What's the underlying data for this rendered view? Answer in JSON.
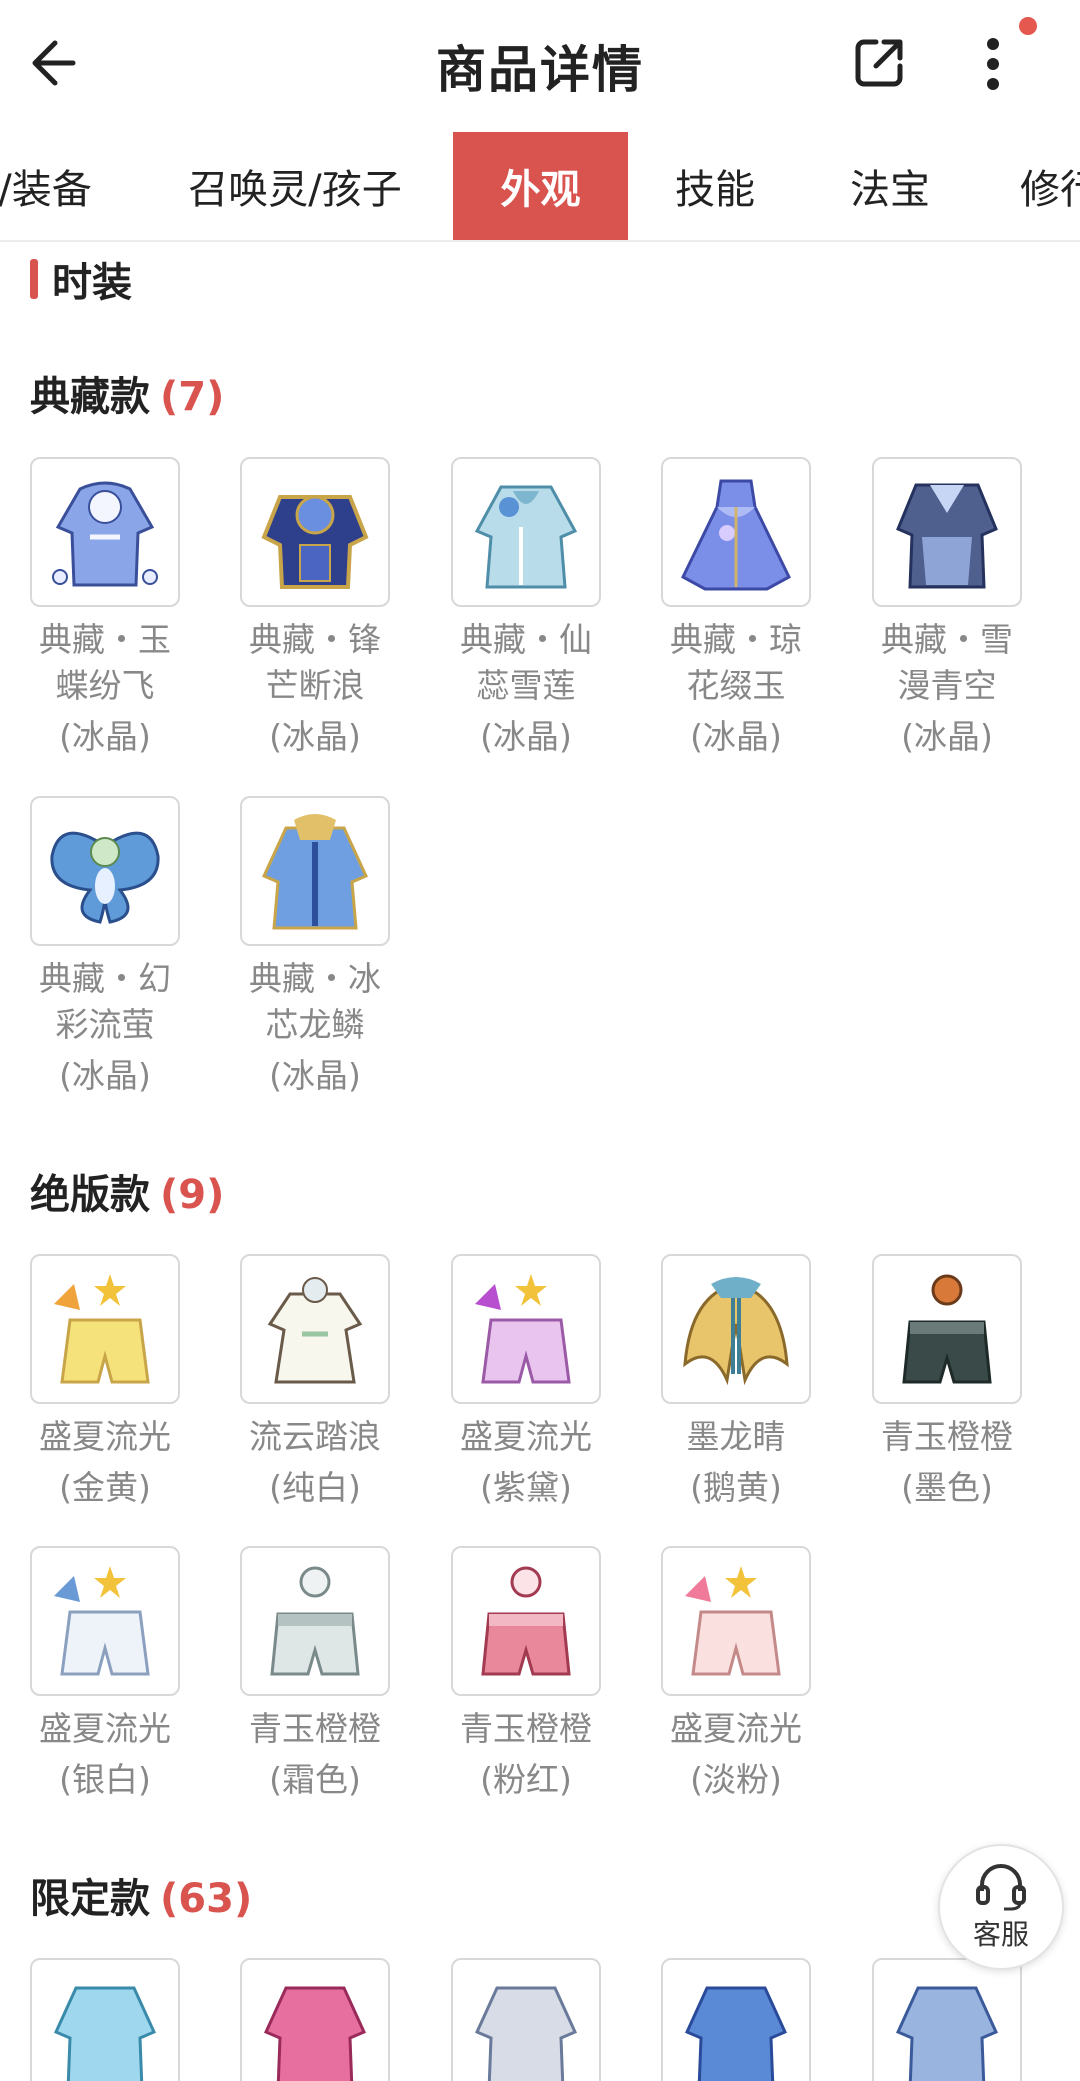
{
  "header": {
    "title": "商品详情",
    "back_icon": "arrow-left-icon",
    "share_icon": "external-share-icon",
    "more_icon": "more-vertical-icon"
  },
  "tabs": [
    {
      "label": "/装备",
      "active": false
    },
    {
      "label": "召唤灵/孩子",
      "active": false
    },
    {
      "label": "外观",
      "active": true
    },
    {
      "label": "技能",
      "active": false
    },
    {
      "label": "法宝",
      "active": false
    },
    {
      "label": "修行",
      "active": false
    }
  ],
  "section": {
    "title": "时装"
  },
  "groups": [
    {
      "title": "典藏款",
      "count": "(7)",
      "items": [
        {
          "name_line1": "典藏・玉",
          "name_line2": "蝶纷飞",
          "variant": "(冰晶)"
        },
        {
          "name_line1": "典藏・锋",
          "name_line2": "芒断浪",
          "variant": "(冰晶)"
        },
        {
          "name_line1": "典藏・仙",
          "name_line2": "蕊雪莲",
          "variant": "(冰晶)"
        },
        {
          "name_line1": "典藏・琼",
          "name_line2": "花缀玉",
          "variant": "(冰晶)"
        },
        {
          "name_line1": "典藏・雪",
          "name_line2": "漫青空",
          "variant": "(冰晶)"
        },
        {
          "name_line1": "典藏・幻",
          "name_line2": "彩流萤",
          "variant": "(冰晶)"
        },
        {
          "name_line1": "典藏・冰",
          "name_line2": "芯龙鳞",
          "variant": "(冰晶)"
        }
      ]
    },
    {
      "title": "绝版款",
      "count": "(9)",
      "items": [
        {
          "name_line1": "盛夏流光",
          "variant": "(金黄)"
        },
        {
          "name_line1": "流云踏浪",
          "variant": "(纯白)"
        },
        {
          "name_line1": "盛夏流光",
          "variant": "(紫黛)"
        },
        {
          "name_line1": "墨龙睛",
          "variant": "(鹅黄)"
        },
        {
          "name_line1": "青玉橙橙",
          "variant": "(墨色)"
        },
        {
          "name_line1": "盛夏流光",
          "variant": "(银白)"
        },
        {
          "name_line1": "青玉橙橙",
          "variant": "(霜色)"
        },
        {
          "name_line1": "青玉橙橙",
          "variant": "(粉红)"
        },
        {
          "name_line1": "盛夏流光",
          "variant": "(淡粉)"
        }
      ]
    },
    {
      "title": "限定款",
      "count": "(63)",
      "items": []
    }
  ],
  "customer_service": {
    "label": "客服",
    "icon": "headset-icon"
  },
  "colors": {
    "accent": "#d9534f",
    "muted_text": "#888888",
    "border": "#d8d8d8"
  }
}
